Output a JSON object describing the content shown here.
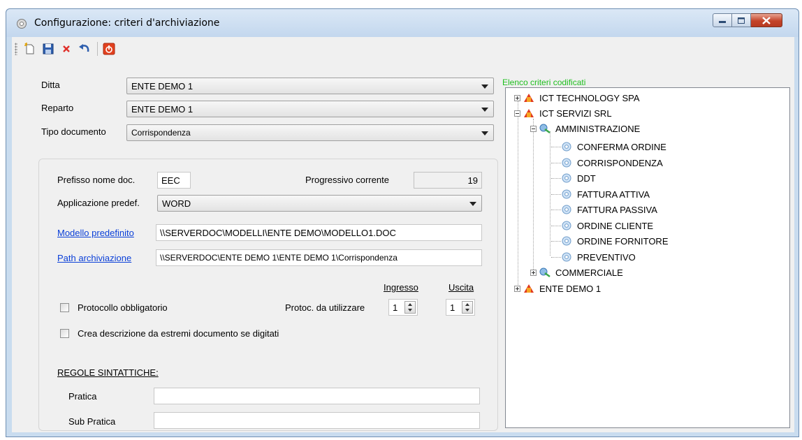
{
  "window": {
    "title": "Configurazione: criteri d'archiviazione"
  },
  "toolbar": {
    "buttons": [
      "new-icon",
      "save-icon",
      "delete-icon",
      "undo-icon",
      "exit-icon"
    ]
  },
  "form": {
    "ditta_label": "Ditta",
    "ditta_value": "ENTE DEMO 1",
    "reparto_label": "Reparto",
    "reparto_value": "ENTE DEMO 1",
    "tipo_label": "Tipo documento",
    "tipo_value": "Corrispondenza"
  },
  "details": {
    "prefisso_label": "Prefisso nome doc.",
    "prefisso_value": "EEC",
    "progressivo_label": "Progressivo corrente",
    "progressivo_value": "19",
    "applicazione_label": "Applicazione predef.",
    "applicazione_value": "WORD",
    "modello_label": "Modello predefinito",
    "modello_value": "\\\\SERVERDOC\\MODELLI\\ENTE DEMO\\MODELLO1.DOC",
    "path_label": "Path archiviazione",
    "path_value": "\\\\SERVERDOC\\ENTE DEMO 1\\ENTE DEMO 1\\Corrispondenza",
    "ingresso_label": "Ingresso",
    "uscita_label": "Uscita",
    "protocollo_label": "Protocollo obbligatorio",
    "protoc_label": "Protoc. da utilizzare",
    "ingresso_value": "1",
    "uscita_value": "1",
    "crea_label": "Crea descrizione da estremi documento se digitati",
    "regole_label": "REGOLE SINTATTICHE:",
    "pratica_label": "Pratica",
    "pratica_value": "",
    "subpratica_label": "Sub Pratica",
    "subpratica_value": ""
  },
  "tree": {
    "legend": "Elenco criteri codificati",
    "nodes": [
      "ICT TECHNOLOGY SPA",
      "ICT SERVIZI SRL",
      "AMMINISTRAZIONE",
      "CONFERMA ORDINE",
      "CORRISPONDENZA",
      "DDT",
      "FATTURA ATTIVA",
      "FATTURA PASSIVA",
      "ORDINE CLIENTE",
      "ORDINE FORNITORE",
      "PREVENTIVO",
      "COMMERCIALE",
      "ENTE DEMO 1"
    ]
  },
  "colors": {
    "legend": "#1fbf1f",
    "link": "#0a3fd8",
    "close": "#c4442a"
  }
}
